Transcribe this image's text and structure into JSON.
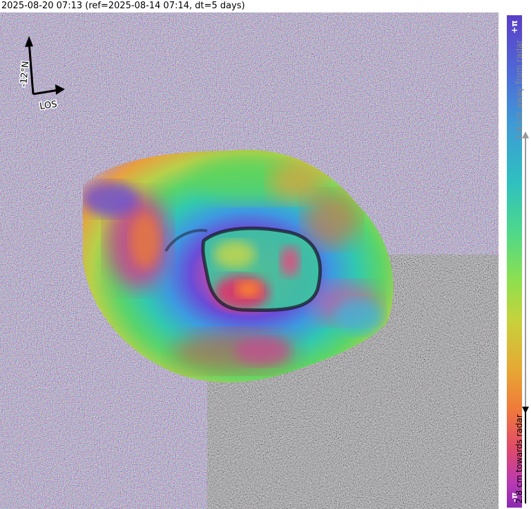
{
  "header": {
    "title": "2025-08-20 07:13 (ref=2025-08-14 07:14, dt=5 days)"
  },
  "compass": {
    "north_label": "-12°N",
    "los_label": "LOS"
  },
  "colorbar": {
    "max_label": "+π",
    "min_label": "-π",
    "away_label": "2.8 cm away from radar",
    "towards_label": "2.8 cm towards radar"
  },
  "colors": {
    "away_arrow": "#9a9a9a",
    "towards_arrow": "#000000"
  }
}
